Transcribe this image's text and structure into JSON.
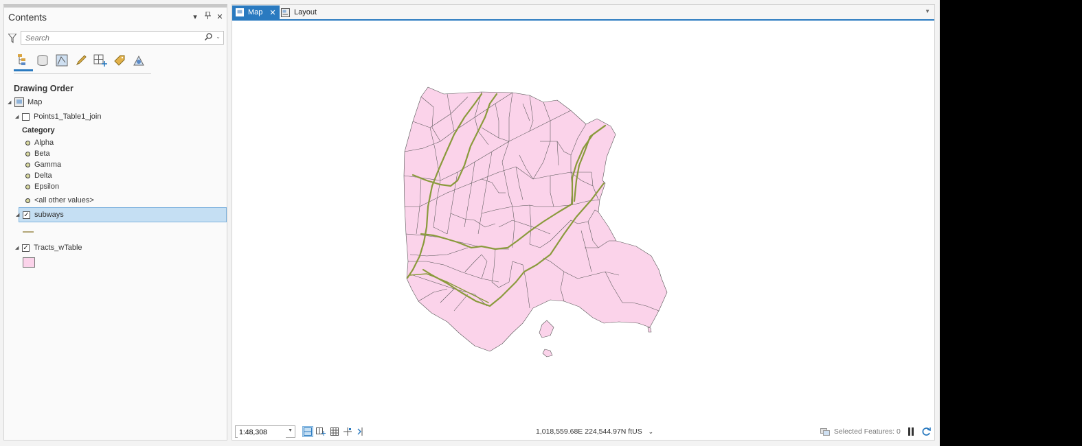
{
  "contents": {
    "title": "Contents",
    "search_placeholder": "Search",
    "section_title": "Drawing Order",
    "map_label": "Map",
    "layers": [
      {
        "name": "Points1_Table1_join",
        "checked": false,
        "heading": "Category",
        "categories": [
          "Alpha",
          "Beta",
          "Gamma",
          "Delta",
          "Epsilon",
          "<all other values>"
        ]
      },
      {
        "name": "subways",
        "checked": true,
        "selected": true
      },
      {
        "name": "Tracts_wTable",
        "checked": true
      }
    ]
  },
  "tabs": [
    {
      "label": "Map",
      "active": true
    },
    {
      "label": "Layout",
      "active": false
    }
  ],
  "status": {
    "scale": "1:48,308",
    "coords": "1,018,559.68E 224,544.97N ftUS",
    "selected_features": "Selected Features: 0"
  },
  "colors": {
    "tract_fill": "#fbd3ea",
    "tract_stroke": "#555555",
    "subway": "#8a9a3c",
    "selection": "#c5dff3",
    "accent": "#2a7ac0"
  }
}
